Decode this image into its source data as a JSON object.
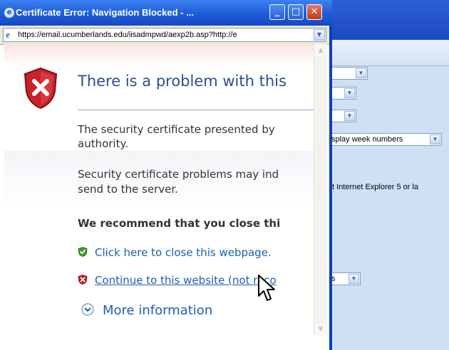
{
  "background_window": {
    "week_numbers_label": "splay week numbers",
    "ie_note": "t Internet Explorer 5 or la",
    "select_value_s": "s"
  },
  "popup": {
    "title": "Certificate Error: Navigation Blocked - ...",
    "address": "https://email.ucumberlands.edu/iisadmpwd/aexp2b.asp?http://e",
    "heading": "There is a problem with this",
    "paragraph1_line1": "The security certificate presented by",
    "paragraph1_line2": "authority.",
    "paragraph2_line1": "Security certificate problems may ind",
    "paragraph2_line2": "send to the server.",
    "recommend": "We recommend that you close thi",
    "close_link": "Click here to close this webpage.",
    "continue_link": "Continue to this website (not reco",
    "more_info": "More information"
  },
  "colors": {
    "title_bar": "#1f5fd8",
    "heading": "#2a4f8e",
    "link": "#1d5fb3",
    "shield": "#c8222b"
  }
}
